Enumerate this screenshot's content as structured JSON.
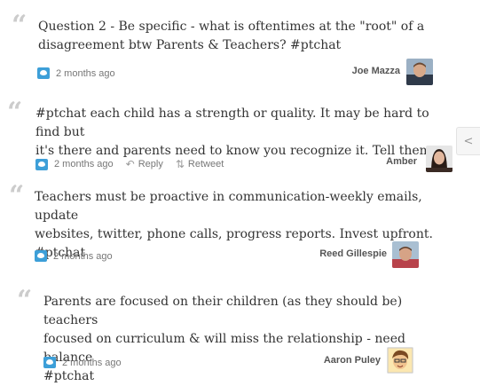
{
  "tweets": [
    {
      "text_lines": [
        "Question 2 - Be specific - what is oftentimes at the \"root\" of a",
        "disagreement btw Parents & Teachers? #ptchat"
      ],
      "time": "2 months ago",
      "author": "Joe Mazza"
    },
    {
      "text_lines": [
        "#ptchat each child has a strength or quality. It may be hard to find but",
        "it's there and parents need to know you recognize it. Tell them."
      ],
      "time": "2 months ago",
      "reply_label": "Reply",
      "retweet_label": "Retweet",
      "author": "Amber"
    },
    {
      "text_lines": [
        "Teachers must be proactive in communication-weekly emails, update",
        "websites, twitter, phone calls, progress reports. Invest upfront.",
        "#ptchat"
      ],
      "time": "2 months ago",
      "author": "Reed Gillespie"
    },
    {
      "text_lines": [
        "Parents are focused on their children (as they should be) teachers",
        "focused on curriculum & will miss the relationship - need balance",
        "#ptchat"
      ],
      "time": "2 months ago",
      "author": "Aaron Puley"
    }
  ],
  "icons": {
    "quote": "open-quote-icon",
    "twitter": "twitter-bird-icon",
    "reply": "reply-arrow-icon",
    "retweet": "retweet-icon",
    "share": "share-icon"
  },
  "colors": {
    "twitter_blue": "#3d9fd8",
    "quote_gray": "#cccccc"
  }
}
